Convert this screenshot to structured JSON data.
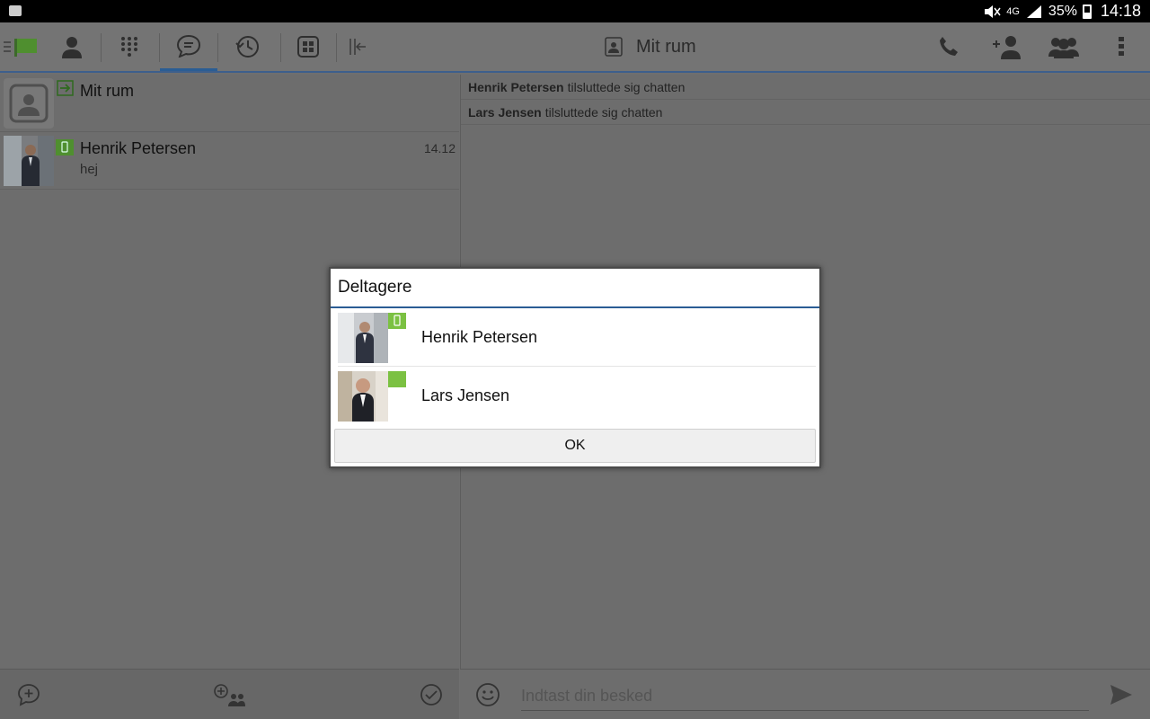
{
  "status_bar": {
    "battery": "35%",
    "time": "14:18",
    "network": "4G"
  },
  "toolbar": {
    "room_title": "Mit rum",
    "active_tab": "chat"
  },
  "conversations": [
    {
      "name": "Mit rum",
      "preview": "",
      "time": ""
    },
    {
      "name": "Henrik Petersen",
      "preview": "hej",
      "time": "14.12"
    }
  ],
  "chat": {
    "messages": [
      {
        "name": "Henrik Petersen",
        "text": "tilsluttede sig chatten"
      },
      {
        "name": "Lars Jensen",
        "text": "tilsluttede sig chatten"
      }
    ],
    "input_placeholder": "Indtast din besked"
  },
  "dialog": {
    "title": "Deltagere",
    "participants": [
      {
        "name": "Henrik Petersen",
        "status": "mobile"
      },
      {
        "name": "Lars Jensen",
        "status": "available"
      }
    ],
    "ok_label": "OK"
  },
  "colors": {
    "accent": "#2a5d94",
    "presence_green": "#7bc142",
    "overlay_gray": "#6f6f6f"
  }
}
